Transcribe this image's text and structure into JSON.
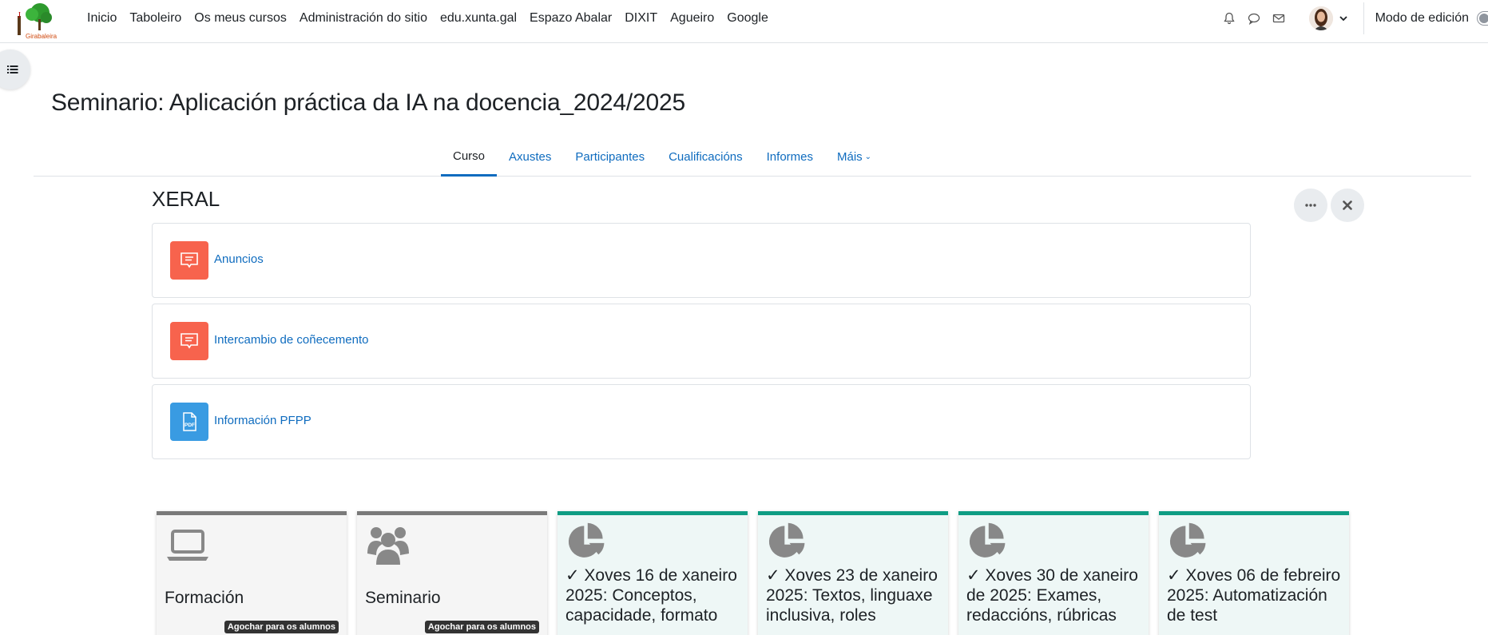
{
  "navbar": {
    "items": [
      {
        "label": "Inicio"
      },
      {
        "label": "Taboleiro"
      },
      {
        "label": "Os meus cursos"
      },
      {
        "label": "Administración do sitio"
      },
      {
        "label": "edu.xunta.gal"
      },
      {
        "label": "Espazo Abalar"
      },
      {
        "label": "DIXIT"
      },
      {
        "label": "Agueiro"
      },
      {
        "label": "Google"
      }
    ],
    "logo_text": "Girabaleira",
    "edit_mode_label": "Modo de edición"
  },
  "header": {
    "title": "Seminario: Aplicación práctica da IA na docencia_2024/2025"
  },
  "secondary_nav": {
    "tabs": [
      {
        "label": "Curso"
      },
      {
        "label": "Axustes"
      },
      {
        "label": "Participantes"
      },
      {
        "label": "Cualificacións"
      },
      {
        "label": "Informes"
      },
      {
        "label": "Máis"
      }
    ]
  },
  "section": {
    "title": "XERAL",
    "activities": [
      {
        "label": "Anuncios",
        "icon": "forum-icon"
      },
      {
        "label": "Intercambio de coñecemento",
        "icon": "forum-icon"
      },
      {
        "label": "Información PFPP",
        "icon": "pdf-icon",
        "icon_text": "PDF"
      }
    ]
  },
  "tiles": [
    {
      "label": "Formación",
      "badge": "Agochar para os alumnos",
      "icon": "laptop-icon"
    },
    {
      "label": "Seminario",
      "badge": "Agochar para os alumnos",
      "icon": "group-icon"
    },
    {
      "text": "✓ Xoves 16 de xaneiro 2025: Conceptos, capacidade, formato",
      "icon": "pie-chart-icon"
    },
    {
      "text": "✓ Xoves 23 de xaneiro 2025: Textos, linguaxe inclusiva, roles",
      "icon": "pie-chart-icon"
    },
    {
      "text": "✓ Xoves 30 de xaneiro de 2025: Exames, redaccións, rúbricas",
      "icon": "pie-chart-icon"
    },
    {
      "text": "✓ Xoves 06 de febreiro 2025: Automatización de test",
      "icon": "pie-chart-icon"
    }
  ],
  "colors": {
    "link": "#0f6cbf",
    "forum_icon_bg": "#f7634d",
    "pdf_icon_bg": "#399be2",
    "tile_grey_border": "#7a7a7a",
    "tile_teal_border": "#0f9d84"
  }
}
